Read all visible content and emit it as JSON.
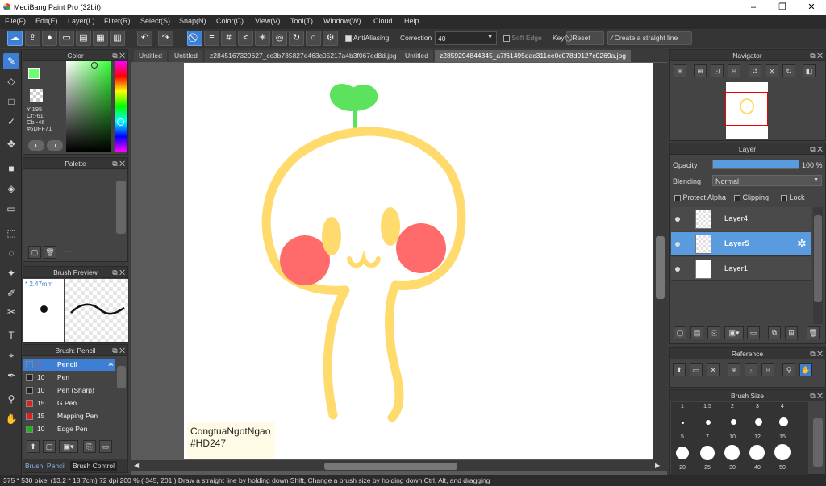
{
  "window": {
    "title": "MediBang Paint Pro (32bit)",
    "minimize": "–",
    "maximize": "❐",
    "close": "✕"
  },
  "menu": [
    "File(F)",
    "Edit(E)",
    "Layer(L)",
    "Filter(R)",
    "Select(S)",
    "Snap(N)",
    "Color(C)",
    "View(V)",
    "Tool(T)",
    "Window(W)",
    "Cloud",
    "Help"
  ],
  "toolbar": {
    "antialiasing": "AntiAliasing",
    "correction_label": "Correction",
    "correction_value": "40",
    "soft_edge": "Soft Edge",
    "key": "Key",
    "reset": "Reset",
    "straight_line": "Create a straight line"
  },
  "color_panel": {
    "title": "Color",
    "readout": [
      "Y:195",
      "Cr:-61",
      "Cb:-46",
      "#6DFF71"
    ],
    "fg": "#6DFF71",
    "bg": "#404040"
  },
  "palette_panel": {
    "title": "Palette",
    "dash": "---"
  },
  "brush_preview": {
    "title": "Brush Preview",
    "size": "* 2.47mm"
  },
  "brush_panel": {
    "title": "Brush: Pencil",
    "items": [
      {
        "size": "7",
        "name": "Pencil",
        "color": "#3d7fd4",
        "selected": true
      },
      {
        "size": "10",
        "name": "Pen",
        "color": "#222222"
      },
      {
        "size": "10",
        "name": "Pen (Sharp)",
        "color": "#222222"
      },
      {
        "size": "15",
        "name": "G Pen",
        "color": "#e02020"
      },
      {
        "size": "15",
        "name": "Mapping Pen",
        "color": "#e02020"
      },
      {
        "size": "10",
        "name": "Edge Pen",
        "color": "#20b020"
      }
    ],
    "tabs": [
      "Brush: Pencil",
      "Brush Control"
    ]
  },
  "doc_tabs": [
    "Untitled",
    "Untitled",
    "z2845167329627_cc3b735827e463c05217a4b3f067ed8d.jpg",
    "Untitled",
    "z2859294844345_a7f61495dac311ee0c078d9127c0269a.jpg"
  ],
  "canvas": {
    "signature_line1": "CongtuaNgotNgao",
    "signature_line2": "#HD247"
  },
  "navigator": {
    "title": "Navigator"
  },
  "layer_panel": {
    "title": "Layer",
    "opacity_label": "Opacity",
    "opacity_value": "100 %",
    "opacity": 1.0,
    "blending_label": "Blending",
    "blending_value": "Normal",
    "protect_alpha": "Protect Alpha",
    "clipping": "Clipping",
    "lock": "Lock",
    "layers": [
      {
        "name": "Layer4"
      },
      {
        "name": "Layer5",
        "selected": true
      },
      {
        "name": "Layer1"
      }
    ]
  },
  "reference": {
    "title": "Reference"
  },
  "brush_size": {
    "title": "Brush Size",
    "sizes_row1": [
      "1",
      "1.5",
      "2",
      "3",
      "4"
    ],
    "sizes_row2": [
      "5",
      "7",
      "10",
      "12",
      "15"
    ],
    "sizes_row3": [
      "20",
      "25",
      "30",
      "40",
      "50"
    ]
  },
  "status": "375 * 530 pixel   (13.2 * 18.7cm)   72 dpi   200 %   ( 345, 201 )   Draw a straight line by holding down Shift, Change a brush size by holding down Ctrl, Alt, and dragging",
  "colors": {
    "accent": "#3d7fd4",
    "stroke_yellow": "#ffdb6e",
    "cheek": "#ff6b6b",
    "sprout": "#5ce25c"
  }
}
